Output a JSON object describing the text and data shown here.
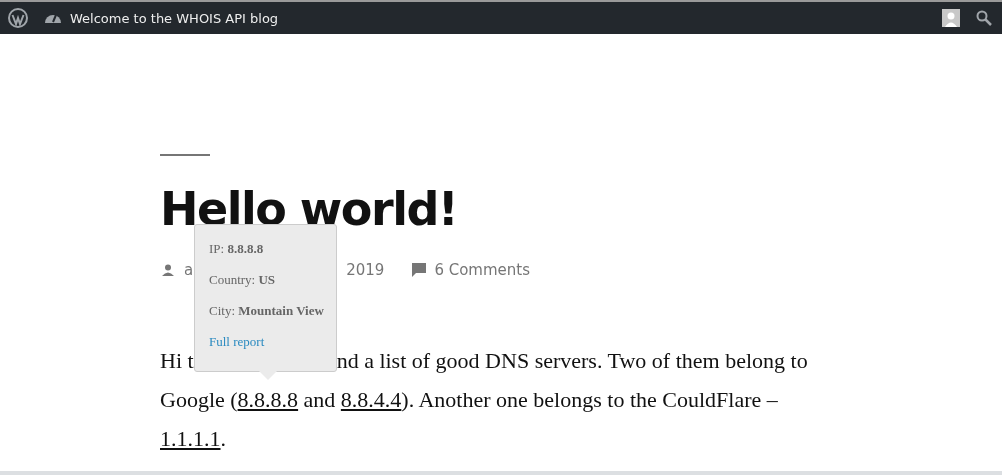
{
  "admin_bar": {
    "site_title": "Welcome to the WHOIS API blog"
  },
  "post": {
    "title": "Hello world!",
    "meta": {
      "author_visible": "a",
      "date_visible": "2019",
      "comments": "6 Comments"
    },
    "first_line": [
      "Hi t",
      "nd a list of good DNS servers. Two of them belong to"
    ],
    "body": [
      {
        "kind": "text",
        "text": "Google ("
      },
      {
        "kind": "link",
        "text": "8.8.8.8"
      },
      {
        "kind": "text",
        "text": " and "
      },
      {
        "kind": "link",
        "text": "8.8.4.4"
      },
      {
        "kind": "text",
        "text": "). Another one belongs to the CouldFlare – "
      },
      {
        "kind": "link",
        "text": "1.1.1.1"
      },
      {
        "kind": "text",
        "text": "."
      }
    ]
  },
  "tooltip": {
    "rows": [
      {
        "label": "IP:",
        "value": "8.8.8.8"
      },
      {
        "label": "Country:",
        "value": "US"
      },
      {
        "label": "City:",
        "value": "Mountain View"
      }
    ],
    "link": "Full report"
  }
}
